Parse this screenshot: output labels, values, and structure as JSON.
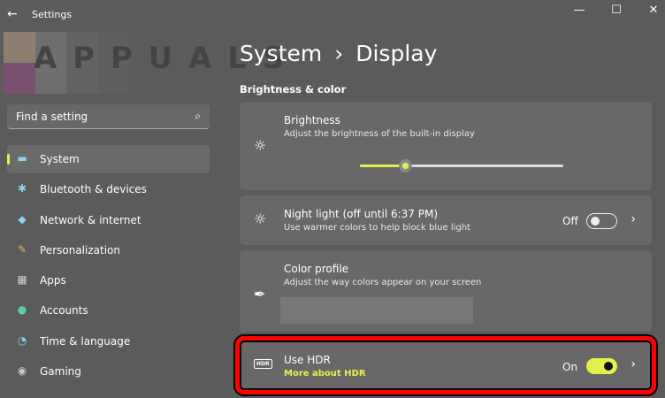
{
  "window": {
    "title": "Settings",
    "back": "←",
    "minimize": "—",
    "maximize": "☐",
    "close": "✕"
  },
  "watermark": "APPUALS",
  "search": {
    "placeholder": "Find a setting",
    "icon": "⌕"
  },
  "nav": [
    {
      "label": "System",
      "icon": "▬",
      "active": true
    },
    {
      "label": "Bluetooth & devices",
      "icon": "✱"
    },
    {
      "label": "Network & internet",
      "icon": "◆"
    },
    {
      "label": "Personalization",
      "icon": "✎"
    },
    {
      "label": "Apps",
      "icon": "▦"
    },
    {
      "label": "Accounts",
      "icon": "●"
    },
    {
      "label": "Time & language",
      "icon": "◔"
    },
    {
      "label": "Gaming",
      "icon": "◉"
    }
  ],
  "breadcrumb": {
    "parent": "System",
    "sep": "›",
    "current": "Display"
  },
  "section": "Brightness & color",
  "brightness": {
    "title": "Brightness",
    "subtitle": "Adjust the brightness of the built-in display",
    "value": 22
  },
  "night_light": {
    "title": "Night light (off until 6:37 PM)",
    "subtitle": "Use warmer colors to help block blue light",
    "state": "Off"
  },
  "color_profile": {
    "title": "Color profile",
    "subtitle": "Adjust the way colors appear on your screen"
  },
  "hdr": {
    "title": "Use HDR",
    "link": "More about HDR",
    "state": "On",
    "icon": "HDR"
  },
  "colors": {
    "accent": "#e6f04a",
    "highlight": "#ff0000"
  }
}
